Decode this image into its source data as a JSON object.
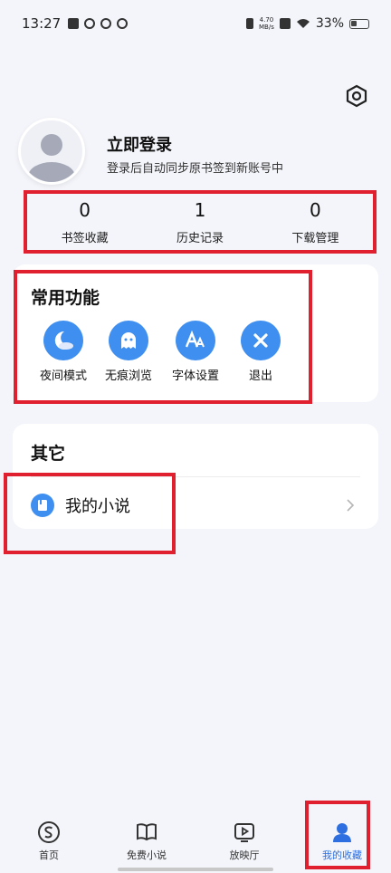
{
  "status_bar": {
    "time": "13:27",
    "net_speed_value": "4.70",
    "net_speed_unit": "MB/s",
    "battery": "33%"
  },
  "profile": {
    "title": "立即登录",
    "subtitle": "登录后自动同步原书签到新账号中"
  },
  "stats": [
    {
      "value": "0",
      "label": "书签收藏"
    },
    {
      "value": "1",
      "label": "历史记录"
    },
    {
      "value": "0",
      "label": "下载管理"
    }
  ],
  "common_functions": {
    "title": "常用功能",
    "items": [
      {
        "label": "夜间模式",
        "icon": "night-mode-icon"
      },
      {
        "label": "无痕浏览",
        "icon": "ghost-icon"
      },
      {
        "label": "字体设置",
        "icon": "font-icon"
      },
      {
        "label": "退出",
        "icon": "close-icon"
      }
    ]
  },
  "other": {
    "title": "其它",
    "items": [
      {
        "label": "我的小说",
        "icon": "book-icon"
      }
    ]
  },
  "bottom_nav": {
    "items": [
      {
        "label": "首页",
        "icon": "home-icon",
        "active": false
      },
      {
        "label": "免费小说",
        "icon": "open-book-icon",
        "active": false
      },
      {
        "label": "放映厅",
        "icon": "play-icon",
        "active": false
      },
      {
        "label": "我的收藏",
        "icon": "user-icon",
        "active": true
      }
    ]
  },
  "colors": {
    "accent": "#3f8ff0",
    "active_nav": "#2d6fe0",
    "highlight": "#e0202e",
    "background": "#f4f5fa"
  }
}
